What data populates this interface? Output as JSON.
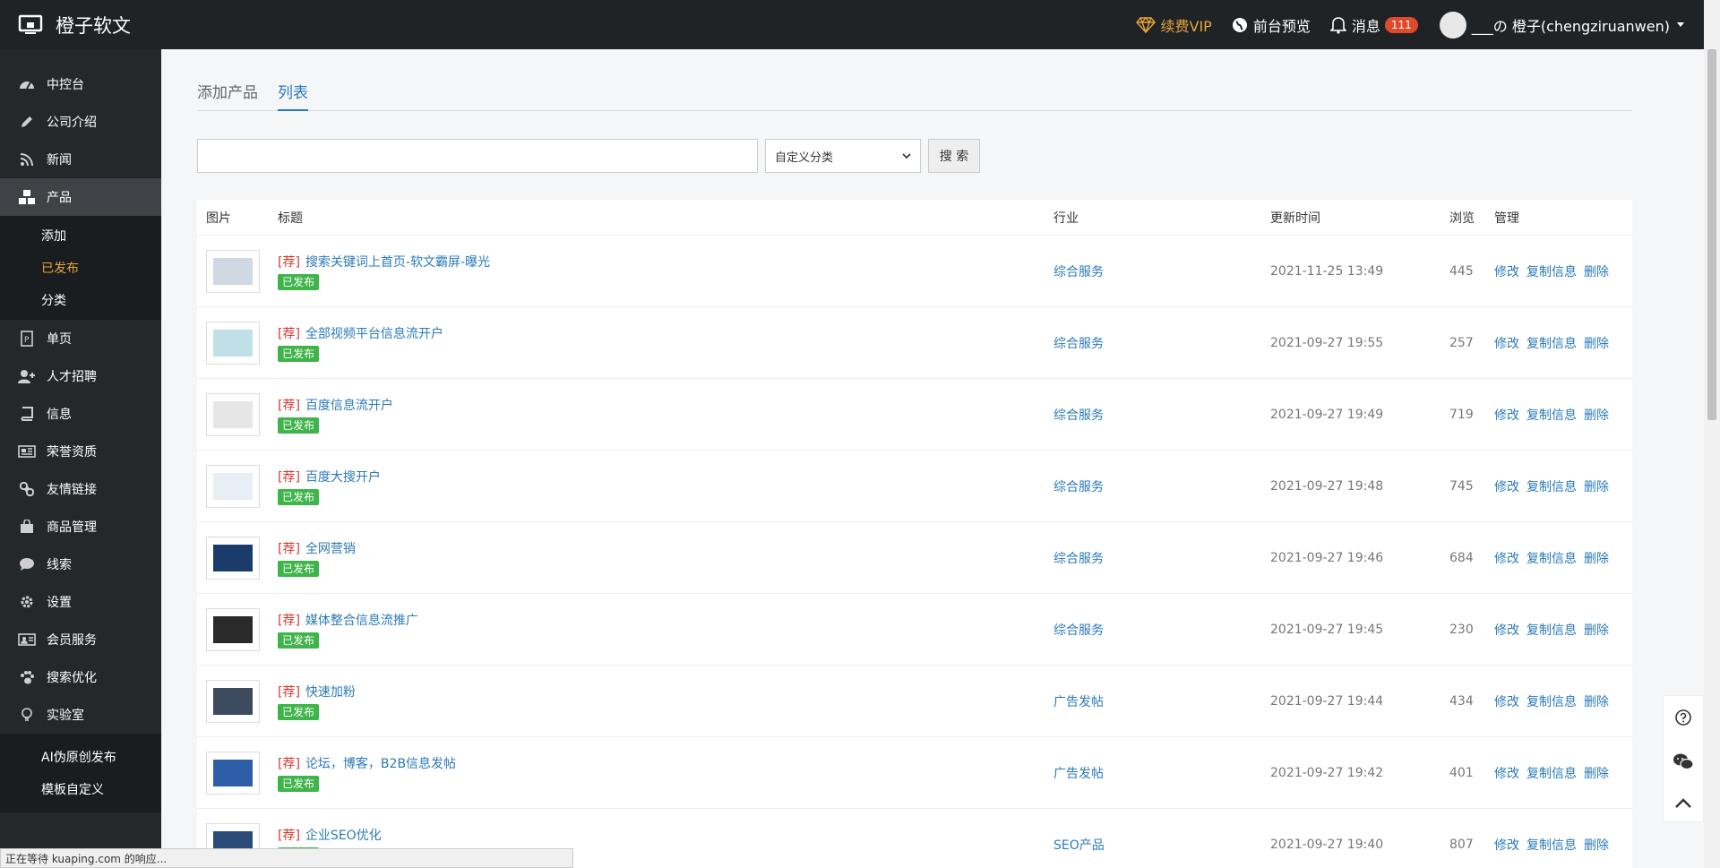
{
  "brand": {
    "name": "橙子软文"
  },
  "top": {
    "vip": "续费VIP",
    "preview": "前台预览",
    "messages": "消息",
    "message_count": "111",
    "user": "___の 橙子(chengziruanwen)"
  },
  "sidebar": {
    "items": [
      {
        "label": "中控台",
        "icon": "dashboard-icon"
      },
      {
        "label": "公司介绍",
        "icon": "pencil-icon"
      },
      {
        "label": "新闻",
        "icon": "rss-icon"
      },
      {
        "label": "产品",
        "icon": "cubes-icon"
      },
      {
        "label": "单页",
        "icon": "page-icon"
      },
      {
        "label": "人才招聘",
        "icon": "user-plus-icon"
      },
      {
        "label": "信息",
        "icon": "book-icon"
      },
      {
        "label": "荣誉资质",
        "icon": "newspaper-icon"
      },
      {
        "label": "友情链接",
        "icon": "link-icon"
      },
      {
        "label": "商品管理",
        "icon": "shopping-bag-icon"
      },
      {
        "label": "线索",
        "icon": "comment-icon"
      },
      {
        "label": "设置",
        "icon": "gear-icon"
      },
      {
        "label": "会员服务",
        "icon": "id-card-icon"
      },
      {
        "label": "搜索优化",
        "icon": "paw-icon"
      },
      {
        "label": "实验室",
        "icon": "bulb-icon"
      }
    ],
    "product_sub": [
      "添加",
      "已发布",
      "分类"
    ],
    "lab_sub": [
      "AI伪原创发布",
      "模板自定义"
    ]
  },
  "tabs": [
    "添加产品",
    "列表"
  ],
  "search": {
    "category_selected": "自定义分类",
    "button": "搜 索"
  },
  "table": {
    "headers": [
      "图片",
      "标题",
      "行业",
      "更新时间",
      "浏览",
      "管理"
    ],
    "rec_tag": "[荐]",
    "status_label": "已发布",
    "actions": [
      "修改",
      "复制信息",
      "删除"
    ],
    "rows": [
      {
        "title": "搜索关键词上首页-软文霸屏-曝光",
        "industry": "综合服务",
        "time": "2021-11-25 13:49",
        "views": "445"
      },
      {
        "title": "全部视频平台信息流开户",
        "industry": "综合服务",
        "time": "2021-09-27 19:55",
        "views": "257"
      },
      {
        "title": "百度信息流开户",
        "industry": "综合服务",
        "time": "2021-09-27 19:49",
        "views": "719"
      },
      {
        "title": "百度大搜开户",
        "industry": "综合服务",
        "time": "2021-09-27 19:48",
        "views": "745"
      },
      {
        "title": "全网营销",
        "industry": "综合服务",
        "time": "2021-09-27 19:46",
        "views": "684"
      },
      {
        "title": "媒体整合信息流推广",
        "industry": "综合服务",
        "time": "2021-09-27 19:45",
        "views": "230"
      },
      {
        "title": "快速加粉",
        "industry": "广告发帖",
        "time": "2021-09-27 19:44",
        "views": "434"
      },
      {
        "title": "论坛，博客，B2B信息发帖",
        "industry": "广告发帖",
        "time": "2021-09-27 19:42",
        "views": "401"
      },
      {
        "title": "企业SEO优化",
        "industry": "SEO产品",
        "time": "2021-09-27 19:40",
        "views": "807"
      }
    ]
  },
  "statusbar": {
    "text": "正在等待 kuaping.com 的响应..."
  },
  "colors": {
    "accent": "#2a7ab9",
    "vip": "#e9a43a",
    "status_green": "#3fb44a",
    "rec_red": "#d9342b"
  }
}
